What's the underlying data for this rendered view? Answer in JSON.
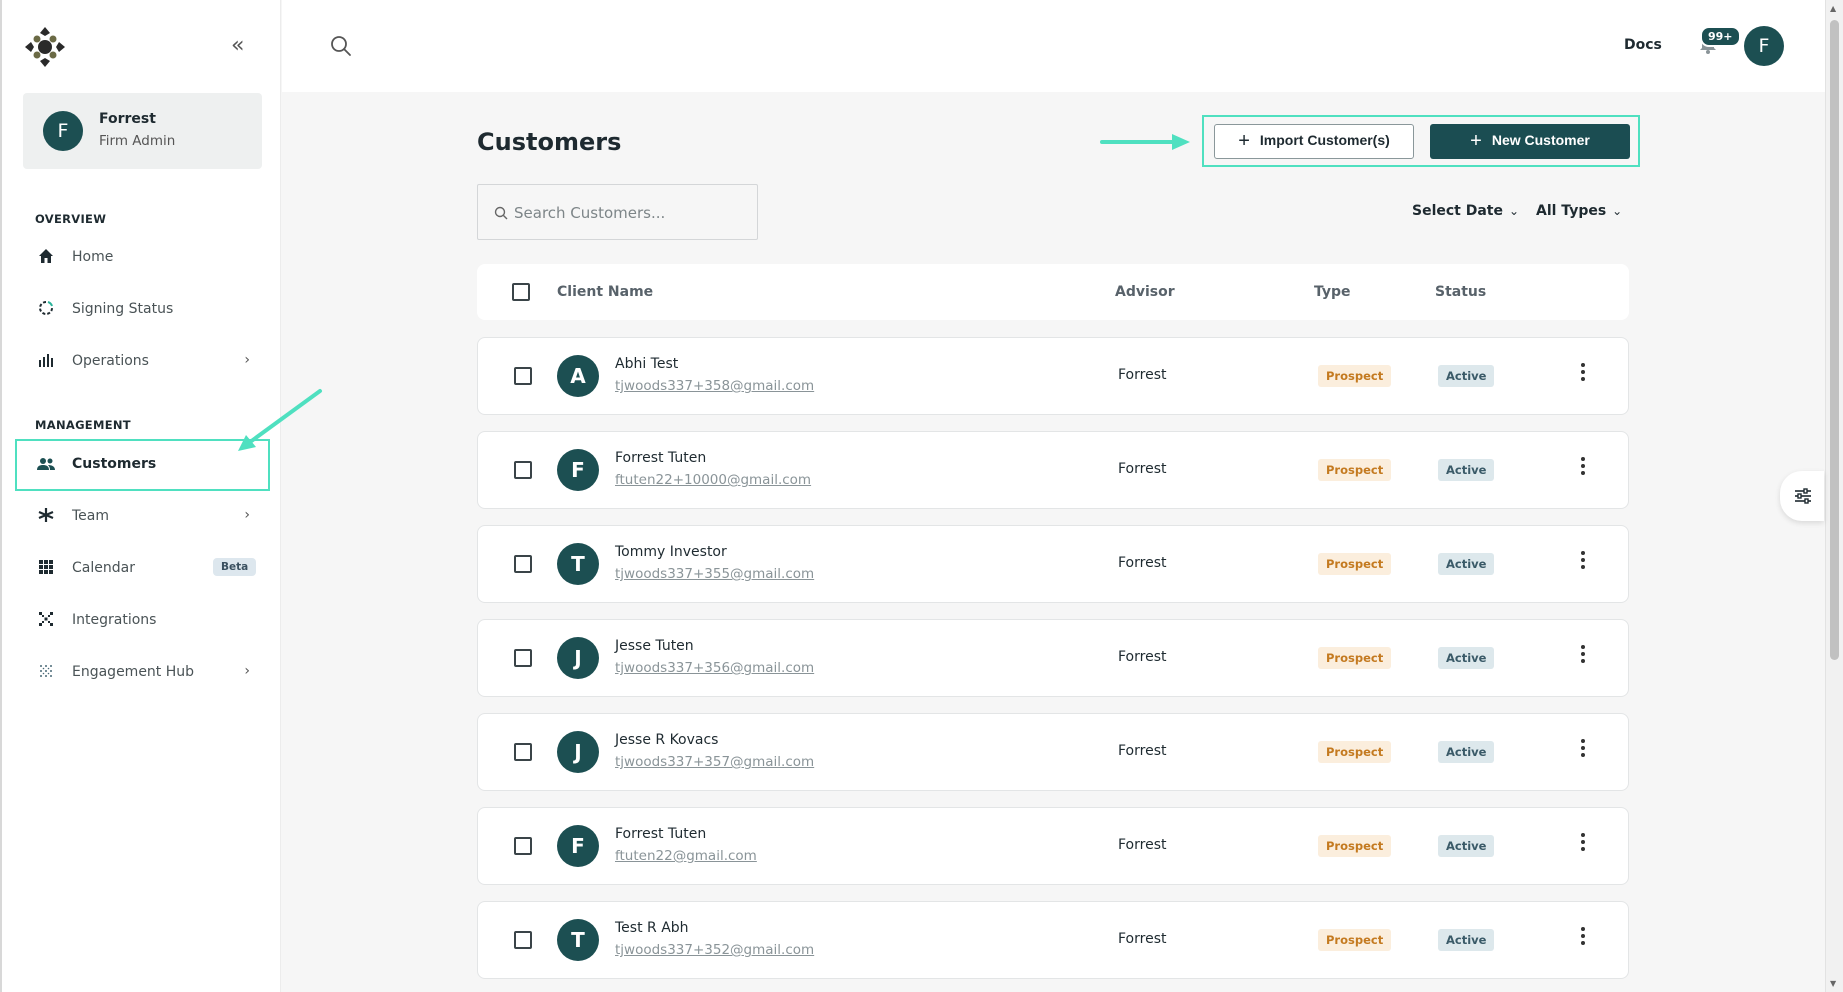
{
  "sidebar": {
    "user": {
      "initial": "F",
      "name": "Forrest",
      "role": "Firm Admin"
    },
    "overview_label": "OVERVIEW",
    "management_label": "MANAGEMENT",
    "overview_items": [
      {
        "label": "Home",
        "icon": "home-icon"
      },
      {
        "label": "Signing Status",
        "icon": "signing-status-icon"
      },
      {
        "label": "Operations",
        "icon": "operations-icon",
        "has_submenu": true
      }
    ],
    "management_items": [
      {
        "label": "Customers",
        "icon": "customers-icon",
        "active": true
      },
      {
        "label": "Team",
        "icon": "team-icon",
        "has_submenu": true
      },
      {
        "label": "Calendar",
        "icon": "calendar-icon",
        "badge": "Beta"
      },
      {
        "label": "Integrations",
        "icon": "integrations-icon"
      },
      {
        "label": "Engagement Hub",
        "icon": "engagement-hub-icon",
        "has_submenu": true
      }
    ]
  },
  "topbar": {
    "docs_label": "Docs",
    "notification_count": "99+",
    "user_initial": "F"
  },
  "main": {
    "title": "Customers",
    "import_label": "Import Customer(s)",
    "new_label": "New Customer",
    "search_placeholder": "Search Customers...",
    "filters": {
      "date": "Select Date",
      "types": "All Types"
    },
    "columns": {
      "client_name": "Client Name",
      "advisor": "Advisor",
      "type": "Type",
      "status": "Status"
    },
    "rows": [
      {
        "initial": "A",
        "name": "Abhi Test",
        "email": "tjwoods337+358@gmail.com",
        "advisor": "Forrest",
        "type": "Prospect",
        "status": "Active"
      },
      {
        "initial": "F",
        "name": "Forrest Tuten",
        "email": "ftuten22+10000@gmail.com",
        "advisor": "Forrest",
        "type": "Prospect",
        "status": "Active"
      },
      {
        "initial": "T",
        "name": "Tommy Investor",
        "email": "tjwoods337+355@gmail.com",
        "advisor": "Forrest",
        "type": "Prospect",
        "status": "Active"
      },
      {
        "initial": "J",
        "name": "Jesse Tuten",
        "email": "tjwoods337+356@gmail.com",
        "advisor": "Forrest",
        "type": "Prospect",
        "status": "Active"
      },
      {
        "initial": "J",
        "name": "Jesse R Kovacs",
        "email": "tjwoods337+357@gmail.com",
        "advisor": "Forrest",
        "type": "Prospect",
        "status": "Active"
      },
      {
        "initial": "F",
        "name": "Forrest Tuten",
        "email": "ftuten22@gmail.com",
        "advisor": "Forrest",
        "type": "Prospect",
        "status": "Active"
      },
      {
        "initial": "T",
        "name": "Test R Abh",
        "email": "tjwoods337+352@gmail.com",
        "advisor": "Forrest",
        "type": "Prospect",
        "status": "Active"
      }
    ]
  },
  "colors": {
    "brand": "#1c4f52",
    "highlight": "#4fe0c0",
    "prospect_bg": "#fbeedd",
    "prospect_text": "#c47a20",
    "active_bg": "#dde8ec"
  }
}
